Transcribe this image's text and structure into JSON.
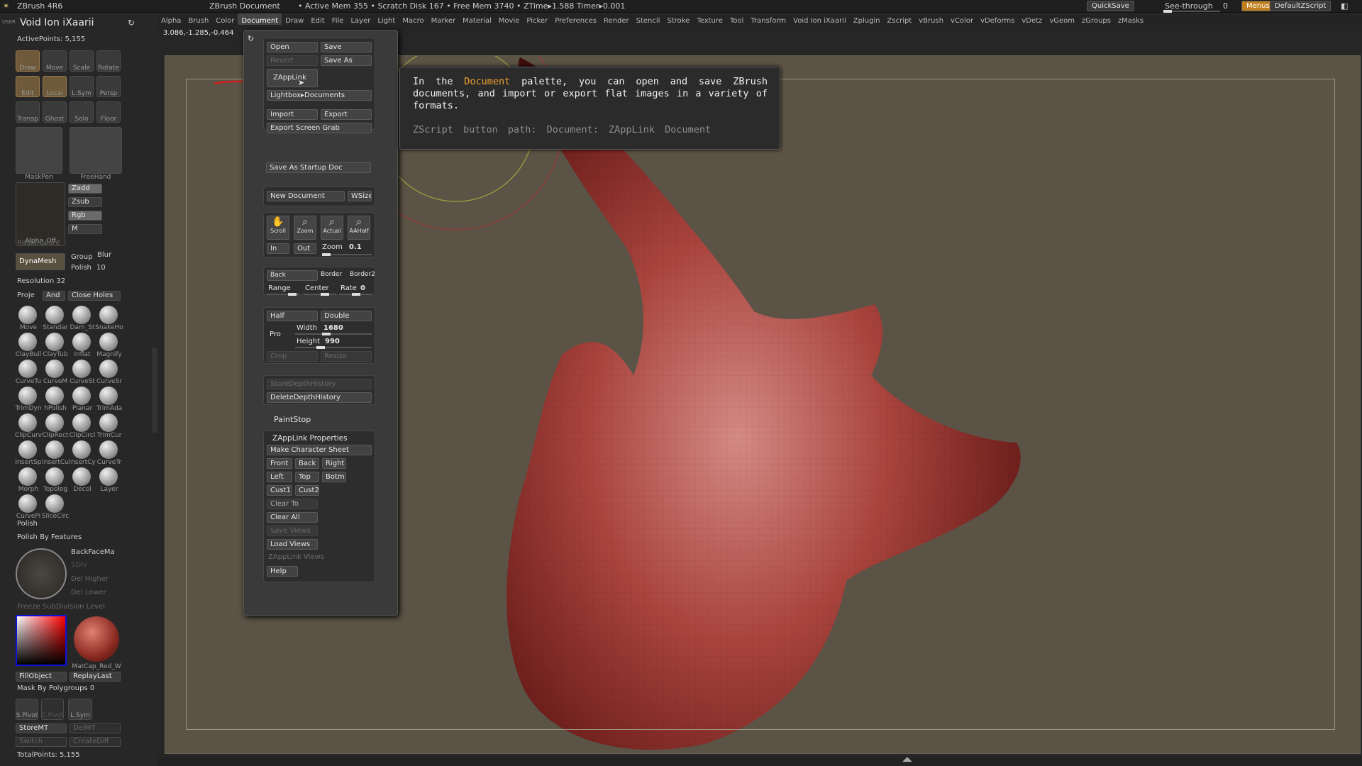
{
  "titlebar": {
    "app": "ZBrush 4R6",
    "document": "ZBrush Document",
    "stats": "• Active Mem 355 • Scratch Disk 167 • Free Mem 3740 • ZTime▸1.588 Timer▸0.001",
    "quicksave": "QuickSave",
    "seethrough": "See-through",
    "seethrough_value": "0",
    "menus": "Menus",
    "script": "DefaultZScript"
  },
  "menubar": [
    "Alpha",
    "Brush",
    "Color",
    "Document",
    "Draw",
    "Edit",
    "File",
    "Layer",
    "Light",
    "Macro",
    "Marker",
    "Material",
    "Movie",
    "Picker",
    "Preferences",
    "Render",
    "Stencil",
    "Stroke",
    "Texture",
    "Tool",
    "Transform",
    "Void Ion iXaarii",
    "Zplugin",
    "Zscript",
    "vBrush",
    "vColor",
    "vDeforms",
    "vDetz",
    "vGeom",
    "zGroups",
    "zMasks"
  ],
  "menubar_active": "Document",
  "left": {
    "user": "USER",
    "project": "Void Ion iXaarii",
    "active_points": "ActivePoints: 5,155",
    "tools_row1": [
      "Draw",
      "Move",
      "Scale",
      "Rotate"
    ],
    "tools_row2": [
      "Edit",
      "Local",
      "L.Sym",
      "Persp"
    ],
    "tools_row3": [
      "Transp",
      "Ghost",
      "Solo",
      "Floor"
    ],
    "brush1": "MaskPen",
    "brush2": "FreeHand",
    "zadd": "Zadd",
    "zsub": "Zsub",
    "rgb": "Rgb",
    "m": "M",
    "alpha_off": "Alpha_Off",
    "radialcount": "RadialCount",
    "dynamesh": "DynaMesh",
    "group": "Group",
    "blur": "Blur",
    "polish": "Polish",
    "polish_val": "10",
    "resolution": "Resolution 32",
    "proje": "Proje",
    "and": "And",
    "close_holes": "Close Holes",
    "brushes": [
      "Move",
      "Standar",
      "Dam_St",
      "SnakeHo",
      "ClayBuil",
      "ClayTub",
      "Inflat",
      "Magnify",
      "CurveTu",
      "CurveM",
      "CurveSt",
      "CurveSr",
      "TrimDyn",
      "hPolish",
      "Planar",
      "TrimAda",
      "ClipCurv",
      "ClipRect",
      "ClipCircl",
      "TrimCur",
      "InsertSp",
      "InsertCu",
      "InsertCy",
      "CurveTr",
      "Morph",
      "Topolog",
      "Decol",
      "Layer",
      "CurvePi",
      "SliceCirc"
    ],
    "polish2": "Polish",
    "polish_features": "Polish By Features",
    "backface": "BackFaceMa",
    "sdiv": "SDiv",
    "del_higher": "Del Higher",
    "del_lower": "Del Lower",
    "freeze": "Freeze SubDivision Level",
    "matcap": "MatCap_Red_W",
    "fillobject": "FillObject",
    "replaylast": "ReplayLast",
    "mask_polygroups": "Mask By Polygroups 0",
    "spivot": "S.Pivot",
    "cpivot": "C.Pivot",
    "lsym2": "L.Sym",
    "storemt": "StoreMT",
    "delmt": "DelMT",
    "switch": "Switch",
    "creatediff": "CreateDiff",
    "totalpoints": "TotalPoints: 5,155"
  },
  "coords": "3.086,-1.285,-0.464",
  "palette": {
    "open": "Open",
    "save": "Save",
    "revert": "Revert",
    "saveas": "Save As",
    "zapplink": "ZAppLink",
    "lightbox": "Lightbox▸Documents",
    "import": "Import",
    "export": "Export",
    "export_grab": "Export Screen Grab",
    "startup": "Save As Startup Doc",
    "new_doc": "New Document",
    "wsize": "WSize",
    "scroll": "Scroll",
    "zoom": "Zoom",
    "actual": "Actual",
    "aahalf": "AAHalf",
    "in": "In",
    "out": "Out",
    "zoom_lbl": "Zoom",
    "zoom_val": "0.1",
    "back": "Back",
    "border": "Border",
    "border2": "Border2",
    "range": "Range",
    "center": "Center",
    "rate": "Rate",
    "rate_val": "0",
    "half": "Half",
    "double": "Double",
    "pro": "Pro",
    "width": "Width",
    "width_val": "1680",
    "height": "Height",
    "height_val": "990",
    "crop": "Crop",
    "resize": "Resize",
    "store_depth": "StoreDepthHistory",
    "delete_depth": "DeleteDepthHistory",
    "paintstop": "PaintStop",
    "zapplink_props": "ZAppLink Properties",
    "make_sheet": "Make Character Sheet",
    "front": "Front",
    "back2": "Back",
    "right": "Right",
    "left": "Left",
    "top": "Top",
    "botm": "Botm",
    "cust1": "Cust1",
    "cust2": "Cust2",
    "clear_to": "Clear To",
    "clear_all": "Clear All",
    "save_views": "Save Views",
    "load_views": "Load Views",
    "zapplink_views": "ZAppLink Views",
    "help": "Help"
  },
  "tooltip": {
    "pre": "In the ",
    "highlight": "Document",
    "post": " palette, you can open and save ZBrush documents, and import or export flat images in a variety of formats.",
    "path": "ZScript button path: Document: ZAppLink Document"
  },
  "colors": {
    "highlight": "#f0a030",
    "model": "#a0403a",
    "canvas": "#5b5345"
  }
}
